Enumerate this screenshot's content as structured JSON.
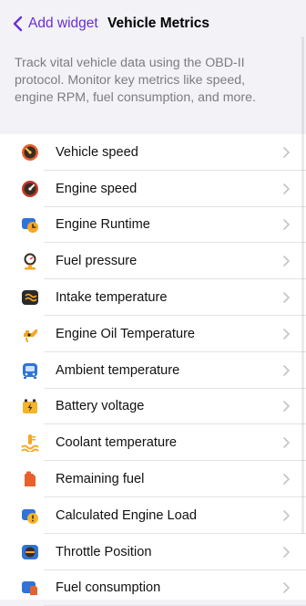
{
  "nav": {
    "back_label": "Add widget",
    "title": "Vehicle Metrics"
  },
  "description": "Track vital vehicle data using the OBD-II protocol. Monitor key metrics like speed, engine RPM, fuel consumption, and more.",
  "colors": {
    "accent": "#6a2fd6",
    "background": "#f2f2f7"
  },
  "items": [
    {
      "label": "Vehicle speed",
      "icon": "speedometer-icon"
    },
    {
      "label": "Engine speed",
      "icon": "tachometer-icon"
    },
    {
      "label": "Engine Runtime",
      "icon": "engine-clock-icon"
    },
    {
      "label": "Fuel pressure",
      "icon": "pressure-gauge-icon"
    },
    {
      "label": "Intake temperature",
      "icon": "intake-air-icon"
    },
    {
      "label": "Engine Oil Temperature",
      "icon": "oil-can-icon"
    },
    {
      "label": "Ambient temperature",
      "icon": "car-thermometer-icon"
    },
    {
      "label": "Battery voltage",
      "icon": "battery-icon"
    },
    {
      "label": "Coolant temperature",
      "icon": "coolant-icon"
    },
    {
      "label": "Remaining fuel",
      "icon": "fuel-can-icon"
    },
    {
      "label": "Calculated Engine Load",
      "icon": "engine-warning-icon"
    },
    {
      "label": "Throttle Position",
      "icon": "throttle-icon"
    },
    {
      "label": "Fuel consumption",
      "icon": "fuel-consumption-icon"
    }
  ]
}
